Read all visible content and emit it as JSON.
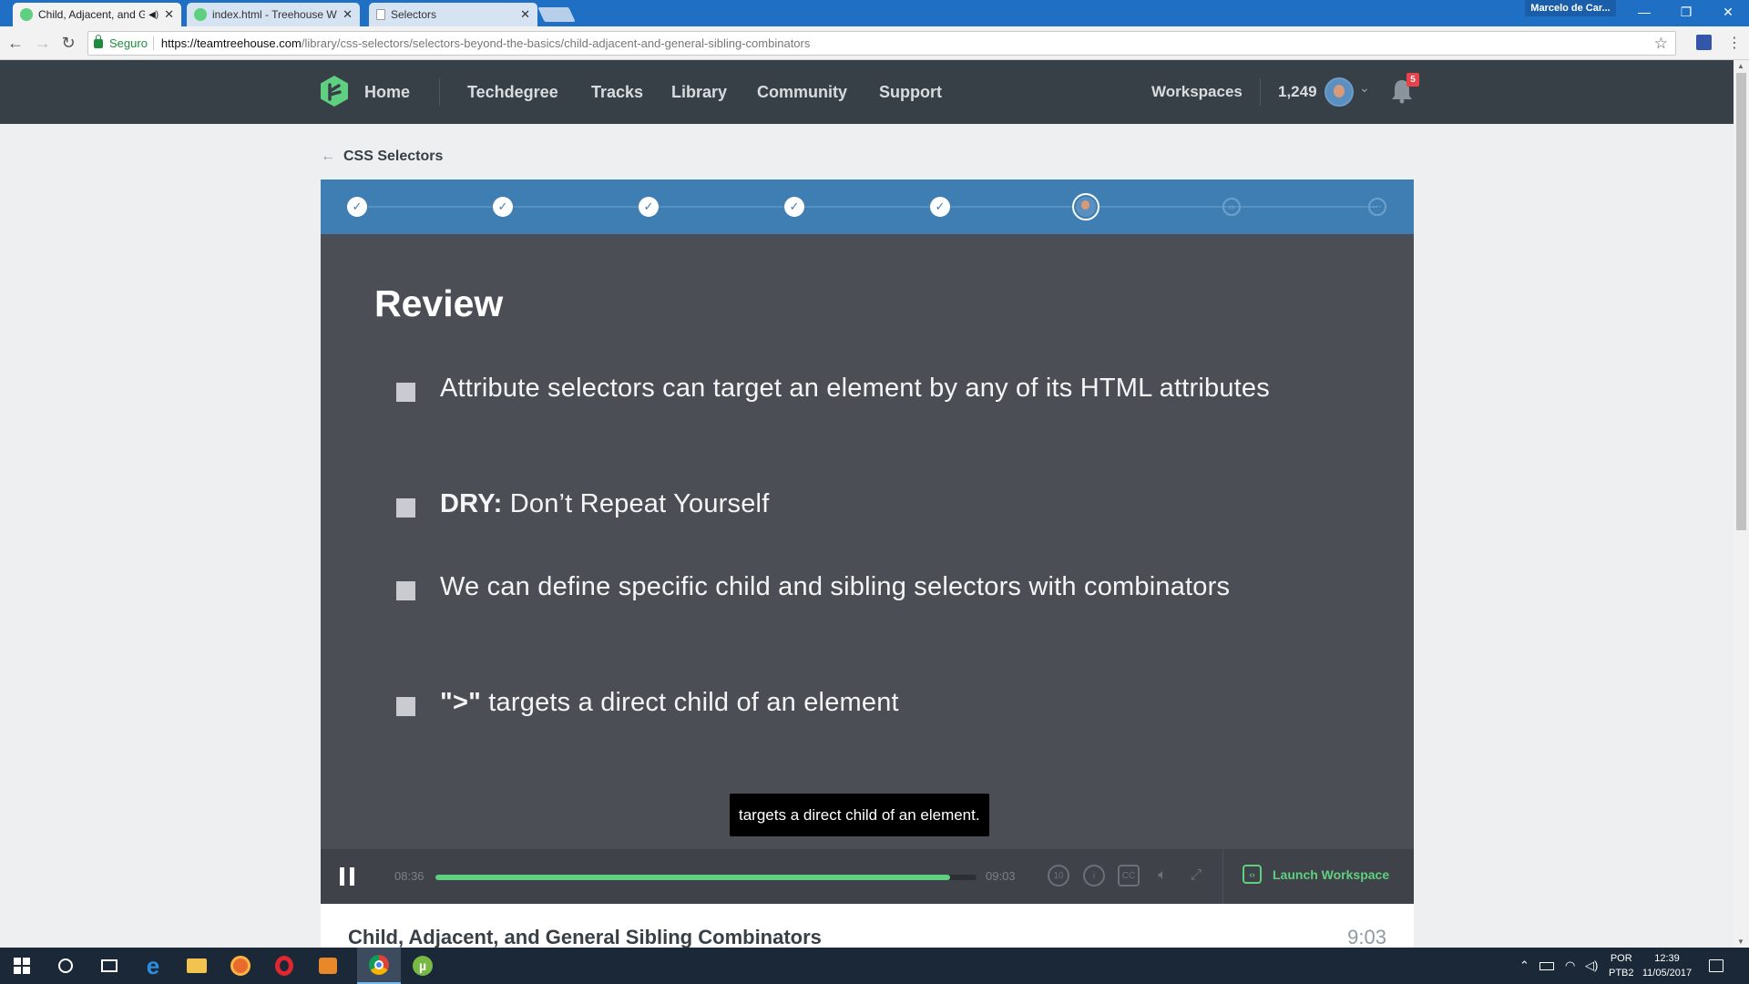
{
  "browser": {
    "tabs": [
      {
        "title": "Child, Adjacent, and G",
        "color": "#5fcf80"
      },
      {
        "title": "index.html - Treehouse W",
        "color": "#5fcf80"
      },
      {
        "title": "Selectors",
        "color": "#999999"
      }
    ],
    "profile_name": "Marcelo de Car...",
    "secure_label": "Seguro",
    "url_host": "https://teamtreehouse.com",
    "url_path": "/library/css-selectors/selectors-beyond-the-basics/child-adjacent-and-general-sibling-combinators"
  },
  "header": {
    "nav": {
      "home": "Home",
      "techdegree": "Techdegree",
      "tracks": "Tracks",
      "library": "Library",
      "community": "Community",
      "support": "Support",
      "workspaces": "Workspaces"
    },
    "points": "1,249",
    "notifications": "5"
  },
  "breadcrumb": {
    "label": "CSS Selectors"
  },
  "steps": [
    "done",
    "done",
    "done",
    "done",
    "done",
    "current",
    "todo",
    "todo"
  ],
  "slide": {
    "title": "Review",
    "bullets": [
      {
        "bold": "",
        "text": "Attribute selectors can target an element by any of its HTML attributes"
      },
      {
        "bold": "DRY:",
        "text": " Don’t Repeat Yourself"
      },
      {
        "bold": "",
        "text": "We can define specific child and sibling selectors with combinators"
      },
      {
        "bold": "\">\"",
        "text": " targets a direct child of an element"
      }
    ]
  },
  "caption": "targets a direct child of an element.",
  "player": {
    "current_time": "08:36",
    "duration": "09:03",
    "progress": 0.951,
    "launch_label": "Launch Workspace"
  },
  "below": {
    "title": "Child, Adjacent, and General Sibling Combinators",
    "duration": "9:03"
  },
  "taskbar": {
    "lang1": "POR",
    "lang2": "PTB2",
    "time": "12:39",
    "date": "11/05/2017"
  },
  "colors": {
    "accent_green": "#5fcf80",
    "header_bg": "#384047",
    "progress_blue": "#3f7eb3",
    "video_bg": "#4b4e55"
  }
}
